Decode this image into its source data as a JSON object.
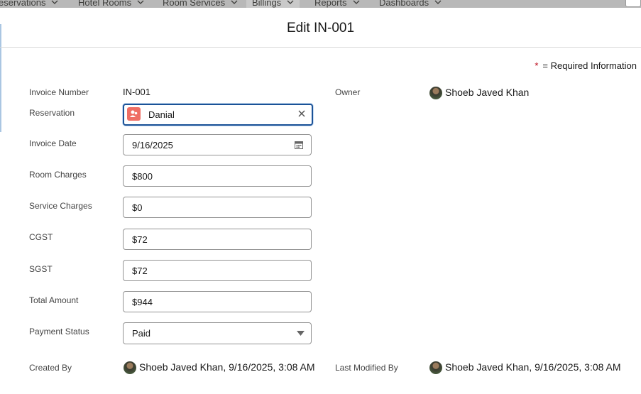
{
  "nav": {
    "items": [
      "eservations",
      "Hotel Rooms",
      "Room Services",
      "Billings",
      "Reports",
      "Dashboards"
    ]
  },
  "modal": {
    "title": "Edit IN-001",
    "required_star": "*",
    "required_note": "= Required Information"
  },
  "form": {
    "invoice_number_label": "Invoice Number",
    "invoice_number": "IN-001",
    "owner_label": "Owner",
    "owner": "Shoeb Javed Khan",
    "reservation_label": "Reservation",
    "reservation": "Danial",
    "invoice_date_label": "Invoice Date",
    "invoice_date": "9/16/2025",
    "room_charges_label": "Room Charges",
    "room_charges": "$800",
    "service_charges_label": "Service Charges",
    "service_charges": "$0",
    "cgst_label": "CGST",
    "cgst": "$72",
    "sgst_label": "SGST",
    "sgst": "$72",
    "total_amount_label": "Total Amount",
    "total_amount": "$944",
    "payment_status_label": "Payment Status",
    "payment_status": "Paid",
    "created_by_label": "Created By",
    "created_by": "Shoeb Javed Khan, 9/16/2025, 3:08 AM",
    "last_modified_label": "Last Modified By",
    "last_modified_by": "Shoeb Javed Khan, 9/16/2025, 3:08 AM"
  },
  "colors": {
    "accent": "#1b5297",
    "required": "#ba0517",
    "lookup_badge": "#ef6e64"
  }
}
